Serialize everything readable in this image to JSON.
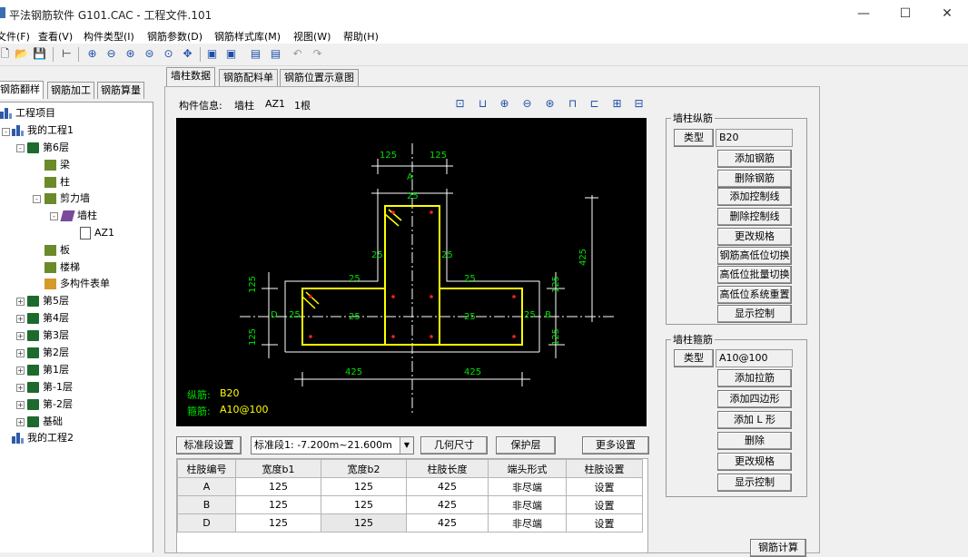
{
  "window": {
    "title": "平法钢筋软件 G101.CAC - 工程文件.101",
    "controls": {
      "minimize": "—",
      "maximize": "☐",
      "close": "✕"
    }
  },
  "menu": [
    {
      "label": "文件(F)"
    },
    {
      "label": "查看(V)"
    },
    {
      "label": "构件类型(I)"
    },
    {
      "label": "钢筋参数(D)"
    },
    {
      "label": "钢筋样式库(M)"
    },
    {
      "label": "视图(W)"
    },
    {
      "label": "帮助(H)"
    }
  ],
  "toolbar": {
    "icons": [
      "new-file-icon",
      "open-folder-icon",
      "save-icon",
      "tree-icon",
      "zoom-in-icon",
      "zoom-out-icon",
      "zoom-window-icon",
      "zoom-extents-icon",
      "zoom-realtime-icon",
      "pan-icon",
      "export-icon",
      "import-icon",
      "undo-icon",
      "redo-icon"
    ]
  },
  "left_tabs": [
    {
      "label": "钢筋翻样"
    },
    {
      "label": "钢筋加工"
    },
    {
      "label": "钢筋算量"
    }
  ],
  "tree": [
    {
      "label": "工程项目",
      "icon": "project-icon",
      "expander": ""
    },
    {
      "label": "我的工程1",
      "icon": "project-icon",
      "expander": "-"
    },
    {
      "label": "第6层",
      "icon": "floor-icon",
      "expander": "-"
    },
    {
      "label": "梁",
      "icon": "component-folder-icon",
      "expander": ""
    },
    {
      "label": "柱",
      "icon": "component-folder-icon",
      "expander": ""
    },
    {
      "label": "剪力墙",
      "icon": "component-folder-icon",
      "expander": "-"
    },
    {
      "label": "墙柱",
      "icon": "wall-column-icon",
      "expander": "-"
    },
    {
      "label": "AZ1",
      "icon": "document-icon",
      "expander": ""
    },
    {
      "label": "板",
      "icon": "component-folder-icon",
      "expander": ""
    },
    {
      "label": "楼梯",
      "icon": "component-folder-icon",
      "expander": ""
    },
    {
      "label": "多构件表单",
      "icon": "multi-form-icon",
      "expander": ""
    },
    {
      "label": "第5层",
      "icon": "floor-icon",
      "expander": "+"
    },
    {
      "label": "第4层",
      "icon": "floor-icon",
      "expander": "+"
    },
    {
      "label": "第3层",
      "icon": "floor-icon",
      "expander": "+"
    },
    {
      "label": "第2层",
      "icon": "floor-icon",
      "expander": "+"
    },
    {
      "label": "第1层",
      "icon": "floor-icon",
      "expander": "+"
    },
    {
      "label": "第-1层",
      "icon": "floor-icon",
      "expander": "+"
    },
    {
      "label": "第-2层",
      "icon": "floor-icon",
      "expander": "+"
    },
    {
      "label": "基础",
      "icon": "floor-icon",
      "expander": "+"
    },
    {
      "label": "我的工程2",
      "icon": "project-icon",
      "expander": ""
    }
  ],
  "content_tabs": [
    {
      "label": "墙柱数据"
    },
    {
      "label": "钢筋配料单"
    },
    {
      "label": "钢筋位置示意图"
    }
  ],
  "component_info": {
    "label": "构件信息:",
    "type": "墙柱",
    "name": "AZ1",
    "count": "1根"
  },
  "drawing_toolbar": [
    "fit-icon",
    "select-icon",
    "zoom-in-icon",
    "zoom-out-icon",
    "zoom-window-icon",
    "dim-icon",
    "section-icon",
    "layer-icon",
    "print-icon"
  ],
  "canvas": {
    "legend": [
      {
        "label": "纵筋:",
        "value": "B20"
      },
      {
        "label": "箍筋:",
        "value": "A10@100"
      }
    ],
    "dims": {
      "top_left": "125",
      "top_right": "125",
      "top_letter": "A",
      "cover_top": "25",
      "left_cover_a": "25",
      "left_cover_b": "25",
      "right_cover_a": "25",
      "right_cover_b": "25",
      "left_arm_top": "25",
      "right_arm_top": "25",
      "right_height": "425",
      "left_125_top": "125",
      "left_125_bottom": "125",
      "right_125_top": "125",
      "right_125_bottom": "125",
      "letter_d": "D",
      "letter_b": "B",
      "left_d_cover": "25",
      "right_b_cover": "25",
      "bottom_left": "425",
      "bottom_right": "425"
    }
  },
  "bottom_controls": {
    "std_section_button": "标准段设置",
    "std_section_select": "标准段1: -7.200m~21.600m",
    "geometry_button": "几何尺寸",
    "cover_button": "保护层",
    "more_button": "更多设置"
  },
  "table": {
    "headers": [
      "柱肢编号",
      "宽度b1",
      "宽度b2",
      "柱肢长度",
      "端头形式",
      "柱肢设置"
    ],
    "rows": [
      [
        "A",
        "125",
        "125",
        "425",
        "非尽端",
        "设置"
      ],
      [
        "B",
        "125",
        "125",
        "425",
        "非尽端",
        "设置"
      ],
      [
        "D",
        "125",
        "125",
        "425",
        "非尽端",
        "设置"
      ]
    ]
  },
  "longitudinal": {
    "group_label": "墙柱纵筋",
    "type_button": "类型",
    "type_value": "B20",
    "buttons": [
      "添加钢筋",
      "删除钢筋",
      "添加控制线",
      "删除控制线",
      "更改规格",
      "钢筋高低位切换",
      "高低位批量切换",
      "高低位系统重置",
      "显示控制"
    ]
  },
  "stirrup": {
    "group_label": "墙柱箍筋",
    "type_button": "类型",
    "type_value": "A10@100",
    "buttons": [
      "添加拉筋",
      "添加四边形",
      "添加 L 形",
      "删除",
      "更改规格",
      "显示控制"
    ]
  },
  "calc_button": "钢筋计算",
  "colors": {
    "canvas_bg": "#000000",
    "outline": "#ffff00",
    "rebar": "#ff2020",
    "dim_text": "#00e000",
    "dim_line": "#ffffff"
  }
}
